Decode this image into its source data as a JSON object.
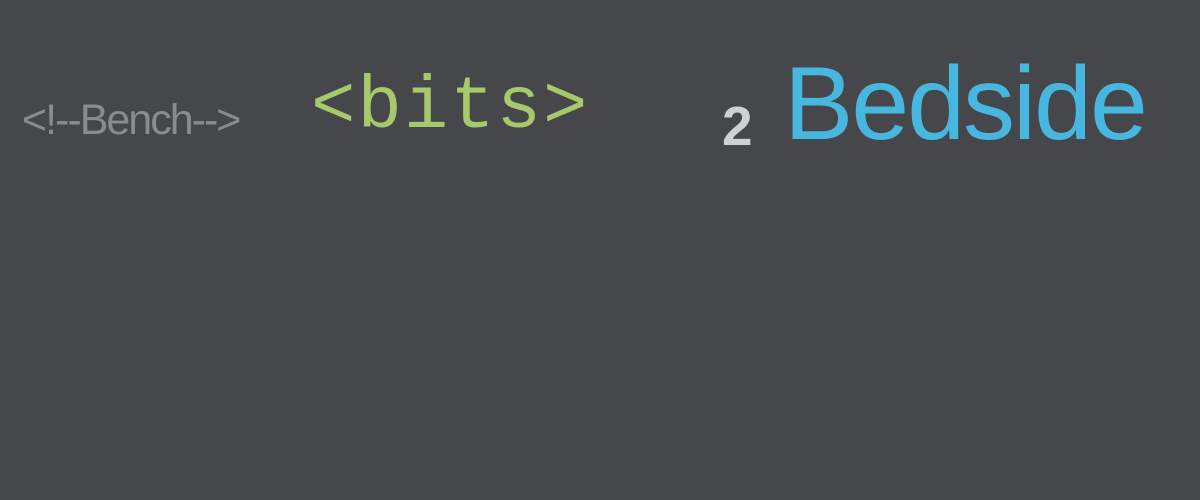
{
  "logo": {
    "comment_text": "<!--Bench-->",
    "bits_text": "<bits>",
    "two_text": "2",
    "bedside_text": "Bedside"
  },
  "colors": {
    "background": "#46474b",
    "comment": "#8a8b8e",
    "bits": "#a6c96c",
    "two": "#cfd0d2",
    "bedside": "#47b7e0"
  }
}
